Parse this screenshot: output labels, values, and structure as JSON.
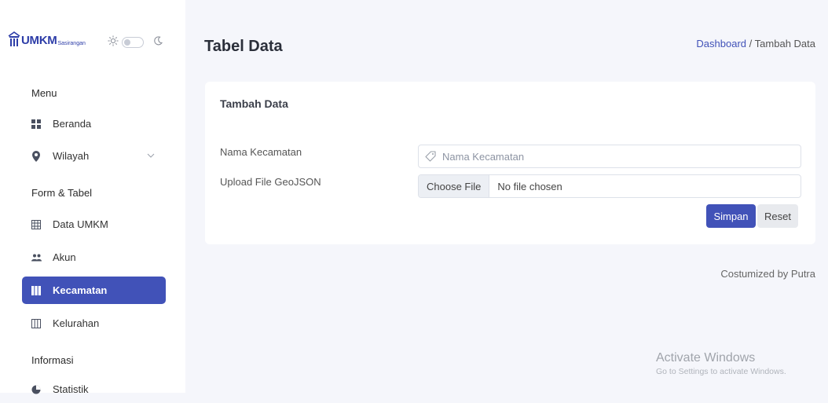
{
  "brand": {
    "name": "UMKM",
    "sub": "Sasirangan"
  },
  "sidebar": {
    "sections": [
      {
        "heading": "Menu"
      },
      {
        "heading": "Form & Tabel"
      },
      {
        "heading": "Informasi"
      }
    ],
    "items": [
      {
        "label": "Beranda",
        "icon": "grid-icon"
      },
      {
        "label": "Wilayah",
        "icon": "map-pin-icon"
      },
      {
        "label": "Data UMKM",
        "icon": "table-icon"
      },
      {
        "label": "Akun",
        "icon": "users-icon"
      },
      {
        "label": "Kecamatan",
        "icon": "columns-icon",
        "active": true
      },
      {
        "label": "Kelurahan",
        "icon": "columns-icon"
      },
      {
        "label": "Statistik",
        "icon": "pie-chart-icon"
      }
    ]
  },
  "header": {
    "title": "Tabel Data",
    "breadcrumb": {
      "link": "Dashboard",
      "separator": "/",
      "current": "Tambah Data"
    }
  },
  "form": {
    "card_title": "Tambah Data",
    "fields": {
      "name_label": "Nama Kecamatan",
      "name_placeholder": "Nama Kecamatan",
      "name_value": "",
      "file_label": "Upload File GeoJSON",
      "file_button": "Choose File",
      "file_status": "No file chosen"
    },
    "buttons": {
      "save": "Simpan",
      "reset": "Reset"
    }
  },
  "footer": {
    "credit": "Costumized by Putra"
  },
  "watermark": {
    "title": "Activate Windows",
    "subtitle": "Go to Settings to activate Windows."
  },
  "colors": {
    "accent": "#4152b8",
    "page_bg": "#f5f6fb",
    "brand": "#2d3da8"
  }
}
